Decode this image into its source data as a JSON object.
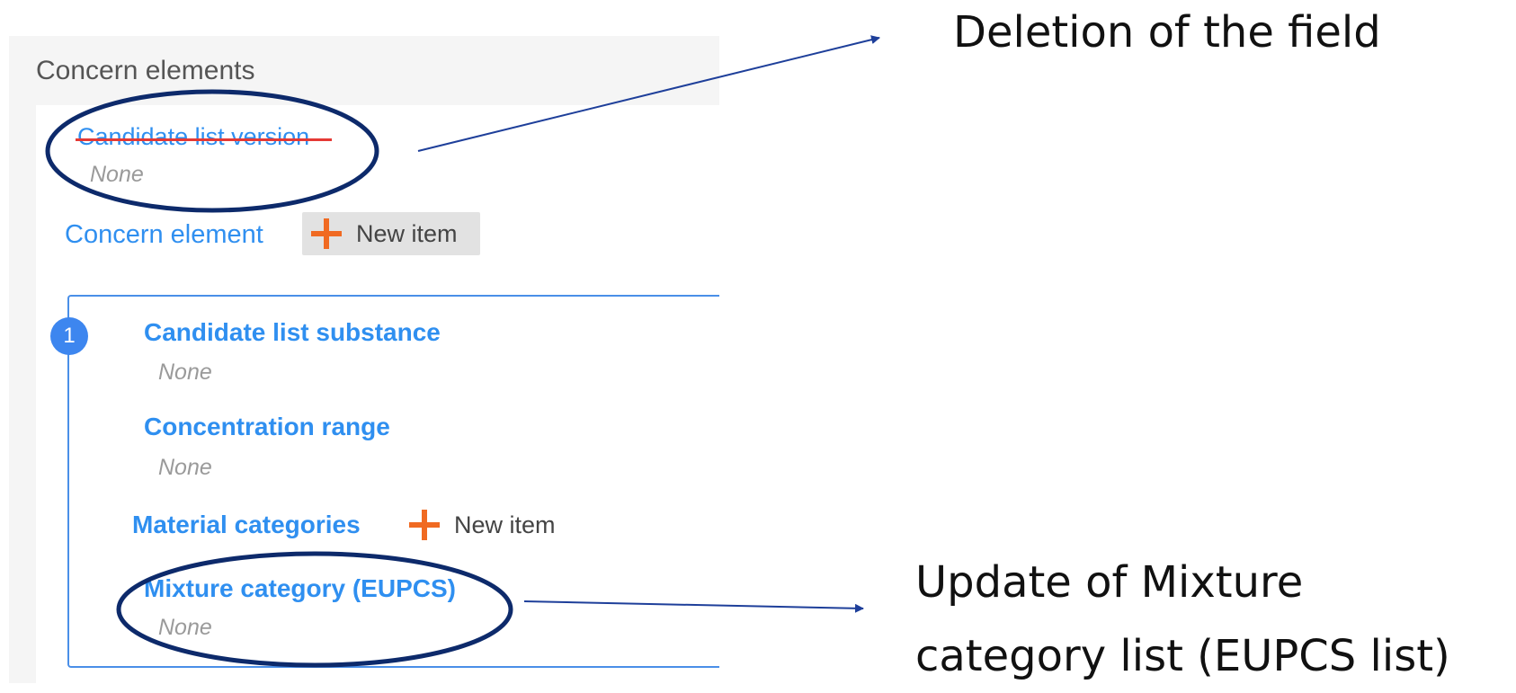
{
  "panel": {
    "title": "Concern elements",
    "candidate_list_version": {
      "label": "Candidate list version",
      "value": "None"
    },
    "concern_element": {
      "label": "Concern element",
      "button_label": "New item"
    },
    "item": {
      "index": "1",
      "candidate_list_substance": {
        "label": "Candidate list substance",
        "value": "None"
      },
      "concentration_range": {
        "label": "Concentration range",
        "value": "None"
      },
      "material_categories": {
        "label": "Material categories",
        "button_label": "New item"
      },
      "mixture_category": {
        "label": "Mixture category (EUPCS)",
        "value": "None"
      }
    }
  },
  "annotations": {
    "deletion": "Deletion of the field",
    "update_line1": "Update of Mixture",
    "update_line2": "category list (EUPCS list)"
  },
  "colors": {
    "label_blue": "#2f8ff0",
    "accent_orange": "#f06a22",
    "strike_red": "#e53935",
    "ellipse_navy": "#0d2a6b",
    "arrow_blue": "#1e3f9a"
  },
  "icons": {
    "add": "plus-icon",
    "item_number": "number-badge"
  }
}
